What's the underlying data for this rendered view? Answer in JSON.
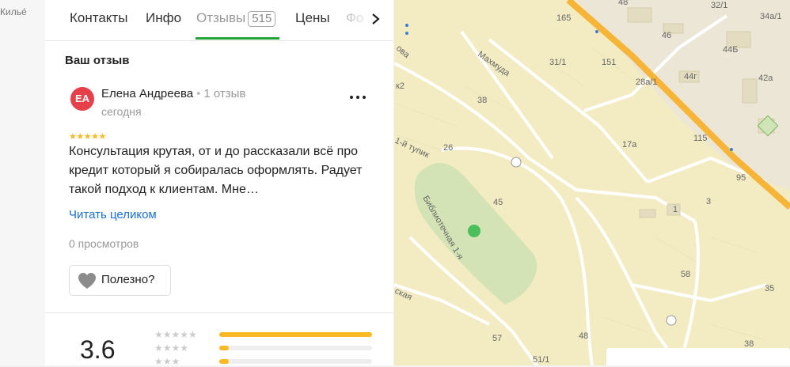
{
  "left_strip": {
    "text": "Килье́"
  },
  "tabs": [
    {
      "label": "Контакты"
    },
    {
      "label": "Инфо"
    },
    {
      "label": "Отзывы",
      "count": "515"
    },
    {
      "label": "Цены"
    },
    {
      "label": "Фо"
    }
  ],
  "review_section": {
    "title": "Ваш отзыв"
  },
  "review": {
    "avatar_initials": "ЕА",
    "author": "Елена Андреева",
    "author_reviews": "1 отзыв",
    "date": "сегодня",
    "stars": "★★★★★",
    "rating": 5,
    "text": "Консультация крутая, от и до рассказали всё про кредит который я собиралась оформлять. Радует такой подход к клиентам. Мне…",
    "read_more": "Читать целиком",
    "views": "0 просмотров",
    "useful_label": "Полезно?"
  },
  "summary": {
    "rating": "3.6",
    "histogram": [
      {
        "stars": "★★★★★",
        "fraction": 1.0
      },
      {
        "stars": "★★★★",
        "fraction": 0.04
      },
      {
        "stars": "★★★",
        "fraction": 0.04
      }
    ]
  },
  "map": {
    "streets": [
      "Махмуда",
      "1-й тупик",
      "Библиотечная 1-я",
      "ова",
      "ская"
    ],
    "house_numbers": [
      "165",
      "48",
      "32/1",
      "34а/1",
      "46",
      "44Б",
      "42а",
      "44г",
      "31/1",
      "151",
      "28а/1",
      "38",
      "26",
      "17а",
      "115",
      "95",
      "45",
      "1",
      "3",
      "58",
      "57",
      "48",
      "38",
      "51/1",
      "35",
      "к2"
    ],
    "colors": {
      "land": "#f3ebc2",
      "road": "#ffffff",
      "highway": "#f7b538",
      "park": "#d3e3b5",
      "building": "#e3dcc0"
    }
  },
  "colors": {
    "accent": "#22a33b",
    "star": "#f8b925",
    "link": "#1a6ed1",
    "avatar": "#e6414a"
  }
}
